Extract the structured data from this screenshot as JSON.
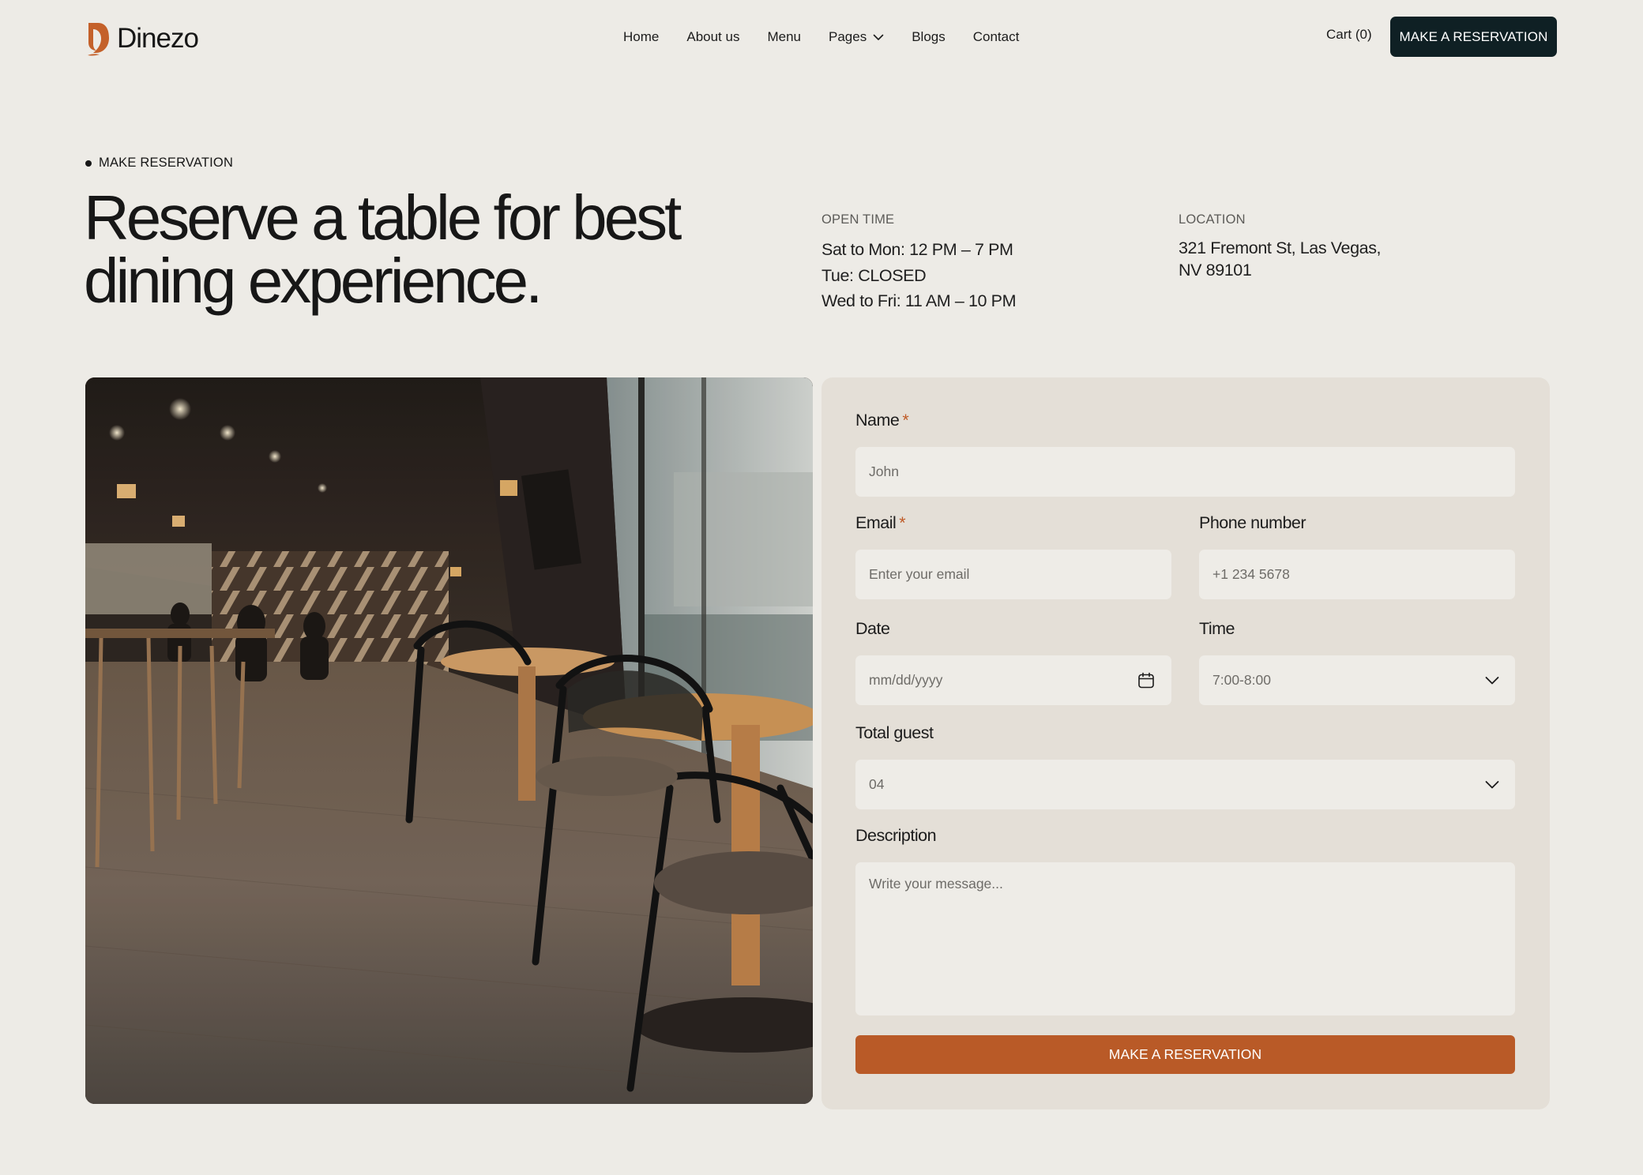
{
  "brand": {
    "name": "Dinezo",
    "accent": "#b95a27",
    "dark": "#0f2024"
  },
  "nav": {
    "items": [
      "Home",
      "About us",
      "Menu",
      "Pages",
      "Blogs",
      "Contact"
    ],
    "pages_icon": "chevron-down-icon",
    "cart": "Cart (0)",
    "cta": "MAKE A RESERVATION"
  },
  "hero": {
    "eyebrow": "MAKE RESERVATION",
    "title_line1": "Reserve a table for best",
    "title_line2": "dining experience.",
    "open_time": {
      "label": "OPEN TIME",
      "lines": [
        "Sat to Mon: 12 PM – 7 PM",
        "Tue: CLOSED",
        "Wed to Fri: 11 AM – 10 PM"
      ]
    },
    "location": {
      "label": "LOCATION",
      "line1": "321 Fremont St, Las Vegas,",
      "line2": "NV 89101"
    }
  },
  "form": {
    "name": {
      "label": "Name",
      "required": "*",
      "placeholder": "John"
    },
    "email": {
      "label": "Email",
      "required": "*",
      "placeholder": "Enter your email"
    },
    "phone": {
      "label": "Phone number",
      "placeholder": "+1 234 5678"
    },
    "date": {
      "label": "Date",
      "placeholder": "mm/dd/yyyy",
      "icon": "calendar-icon"
    },
    "time": {
      "label": "Time",
      "value": "7:00-8:00",
      "icon": "chevron-down-icon"
    },
    "guests": {
      "label": "Total guest",
      "value": "04",
      "icon": "chevron-down-icon"
    },
    "description": {
      "label": "Description",
      "placeholder": "Write your message..."
    },
    "submit": "MAKE A RESERVATION"
  }
}
